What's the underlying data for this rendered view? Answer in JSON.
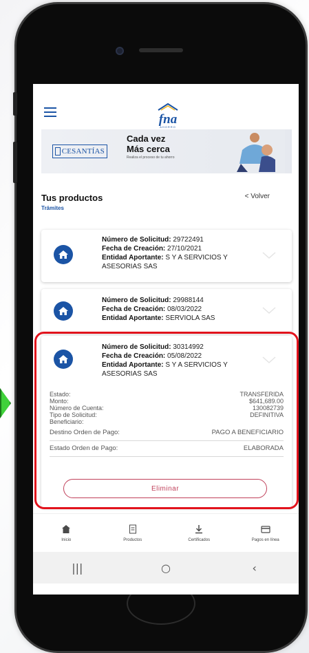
{
  "header": {
    "logo_text": "fna",
    "logo_sub": "AHORRO"
  },
  "banner": {
    "brand": "CESANTÍAS",
    "title_line1": "Cada vez",
    "title_line2": "Más cerca",
    "subtitle": "Realiza el proceso de tu ahorro"
  },
  "section": {
    "title": "Tus productos",
    "subtitle": "Trámites",
    "back_label": "< Volver"
  },
  "cards": [
    {
      "numero_label": "Número de Solicitud:",
      "numero": "29722491",
      "fecha_label": "Fecha de Creación:",
      "fecha": "27/10/2021",
      "entidad_label": "Entidad Aportante:",
      "entidad": "S Y A SERVICIOS Y ASESORIAS SAS"
    },
    {
      "numero_label": "Número de Solicitud:",
      "numero": "29988144",
      "fecha_label": "Fecha de Creación:",
      "fecha": "08/03/2022",
      "entidad_label": "Entidad Aportante:",
      "entidad": "SERVIOLA SAS"
    },
    {
      "numero_label": "Número de Solicitud:",
      "numero": "30314992",
      "fecha_label": "Fecha de Creación:",
      "fecha": "05/08/2022",
      "entidad_label": "Entidad Aportante:",
      "entidad": "S Y A SERVICIOS Y ASESORIAS SAS"
    }
  ],
  "details": {
    "estado_label": "Estado:",
    "estado_value": "TRANSFERIDA",
    "monto_label": "Monto:",
    "monto_value": "$641,689.00",
    "cuenta_label": "Número de Cuenta:",
    "cuenta_value": "130082739",
    "tipo_label": "Tipo de Solicitud:",
    "tipo_value": "DEFINITIVA",
    "beneficiario_label": "Beneficiario:",
    "destino_label": "Destino Orden de Pago:",
    "destino_value": "PAGO A BENEFICIARIO",
    "estado_orden_label": "Estado Orden de Pago:",
    "estado_orden_value": "ELABORADA",
    "delete_label": "Eliminar"
  },
  "bottom_nav": [
    {
      "label": "Inicio",
      "icon": "home-icon"
    },
    {
      "label": "Productos",
      "icon": "document-icon"
    },
    {
      "label": "Certificados",
      "icon": "download-icon"
    },
    {
      "label": "Pagos en línea",
      "icon": "card-icon"
    }
  ],
  "colors": {
    "brand_blue": "#1b54a5",
    "highlight_red": "#e2121c",
    "delete_red": "#c0405a"
  }
}
